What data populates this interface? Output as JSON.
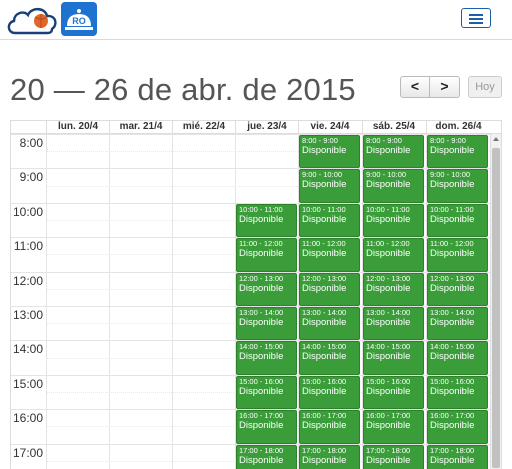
{
  "header": {
    "logo_text": "RO",
    "menu_icon": "hamburger-icon"
  },
  "toolbar": {
    "title": "20 — 26 de abr. de 2015",
    "prev_label": "<",
    "next_label": ">",
    "today_label": "Hoy"
  },
  "calendar": {
    "days": [
      "lun. 20/4",
      "mar. 21/4",
      "mié. 22/4",
      "jue. 23/4",
      "vie. 24/4",
      "sáb. 25/4",
      "dom. 26/4"
    ],
    "hours": [
      "8:00",
      "9:00",
      "10:00",
      "11:00",
      "12:00",
      "13:00",
      "14:00",
      "15:00",
      "16:00",
      "17:00"
    ],
    "status_label": "Disponible",
    "events": [
      {
        "day": 4,
        "start": 8,
        "time": "8:00 - 9:00"
      },
      {
        "day": 4,
        "start": 9,
        "time": "9:00 - 10:00"
      },
      {
        "day": 4,
        "start": 10,
        "time": "10:00 - 11:00"
      },
      {
        "day": 4,
        "start": 11,
        "time": "11:00 - 12:00"
      },
      {
        "day": 4,
        "start": 12,
        "time": "12:00 - 13:00"
      },
      {
        "day": 4,
        "start": 13,
        "time": "13:00 - 14:00"
      },
      {
        "day": 4,
        "start": 14,
        "time": "14:00 - 15:00"
      },
      {
        "day": 4,
        "start": 15,
        "time": "15:00 - 16:00"
      },
      {
        "day": 4,
        "start": 16,
        "time": "16:00 - 17:00"
      },
      {
        "day": 4,
        "start": 17,
        "time": "17:00 - 18:00"
      },
      {
        "day": 5,
        "start": 8,
        "time": "8:00 - 9:00"
      },
      {
        "day": 5,
        "start": 9,
        "time": "9:00 - 10:00"
      },
      {
        "day": 5,
        "start": 10,
        "time": "10:00 - 11:00"
      },
      {
        "day": 5,
        "start": 11,
        "time": "11:00 - 12:00"
      },
      {
        "day": 5,
        "start": 12,
        "time": "12:00 - 13:00"
      },
      {
        "day": 5,
        "start": 13,
        "time": "13:00 - 14:00"
      },
      {
        "day": 5,
        "start": 14,
        "time": "14:00 - 15:00"
      },
      {
        "day": 5,
        "start": 15,
        "time": "15:00 - 16:00"
      },
      {
        "day": 5,
        "start": 16,
        "time": "16:00 - 17:00"
      },
      {
        "day": 5,
        "start": 17,
        "time": "17:00 - 18:00"
      },
      {
        "day": 6,
        "start": 8,
        "time": "8:00 - 9:00"
      },
      {
        "day": 6,
        "start": 9,
        "time": "9:00 - 10:00"
      },
      {
        "day": 6,
        "start": 10,
        "time": "10:00 - 11:00"
      },
      {
        "day": 6,
        "start": 11,
        "time": "11:00 - 12:00"
      },
      {
        "day": 6,
        "start": 12,
        "time": "12:00 - 13:00"
      },
      {
        "day": 6,
        "start": 13,
        "time": "13:00 - 14:00"
      },
      {
        "day": 6,
        "start": 14,
        "time": "14:00 - 15:00"
      },
      {
        "day": 6,
        "start": 15,
        "time": "15:00 - 16:00"
      },
      {
        "day": 6,
        "start": 16,
        "time": "16:00 - 17:00"
      },
      {
        "day": 6,
        "start": 17,
        "time": "17:00 - 18:00"
      },
      {
        "day": 3,
        "start": 10,
        "time": "10:00 - 11:00"
      },
      {
        "day": 3,
        "start": 11,
        "time": "11:00 - 12:00"
      },
      {
        "day": 3,
        "start": 12,
        "time": "12:00 - 13:00"
      },
      {
        "day": 3,
        "start": 13,
        "time": "13:00 - 14:00"
      },
      {
        "day": 3,
        "start": 14,
        "time": "14:00 - 15:00"
      },
      {
        "day": 3,
        "start": 15,
        "time": "15:00 - 16:00"
      },
      {
        "day": 3,
        "start": 16,
        "time": "16:00 - 17:00"
      },
      {
        "day": 3,
        "start": 17,
        "time": "17:00 - 18:00"
      }
    ]
  },
  "colors": {
    "event_bg": "#3a9d3a",
    "accent": "#1c5fa8"
  }
}
